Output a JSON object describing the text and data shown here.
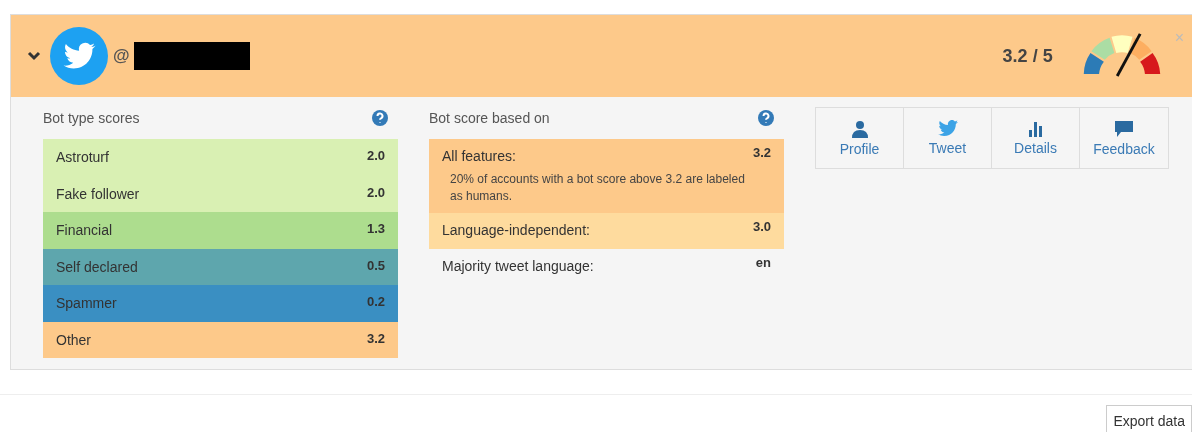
{
  "header": {
    "handle_prefix": "@",
    "score": "3.2 / 5",
    "close": "×"
  },
  "bot_type_scores": {
    "title": "Bot type scores",
    "rows": [
      {
        "label": "Astroturf",
        "score": "2.0",
        "color": "#d9f0b3"
      },
      {
        "label": "Fake follower",
        "score": "2.0",
        "color": "#d9f0b3"
      },
      {
        "label": "Financial",
        "score": "1.3",
        "color": "#addd8e"
      },
      {
        "label": "Self declared",
        "score": "0.5",
        "color": "#5ea6ad"
      },
      {
        "label": "Spammer",
        "score": "0.2",
        "color": "#3a8fc2"
      },
      {
        "label": "Other",
        "score": "3.2",
        "color": "#fdc98a"
      }
    ]
  },
  "bot_score_based_on": {
    "title": "Bot score based on",
    "rows": [
      {
        "label": "All features:",
        "score": "3.2",
        "note": "20% of accounts with a bot score above 3.2 are labeled as humans.",
        "color": "#fdc98a"
      },
      {
        "label": "Language-independent:",
        "score": "3.0",
        "color": "#fedb9e"
      },
      {
        "label": "Majority tweet language:",
        "score": "en",
        "color": "#f5f5f5"
      }
    ]
  },
  "actions": [
    {
      "label": "Profile",
      "kind": "profile"
    },
    {
      "label": "Tweet",
      "kind": "tweet"
    },
    {
      "label": "Details",
      "kind": "details"
    },
    {
      "label": "Feedback",
      "kind": "feedback"
    }
  ],
  "export_button": "Export data"
}
